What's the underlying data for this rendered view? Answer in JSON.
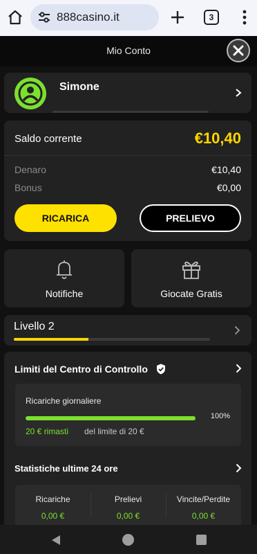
{
  "browser": {
    "url": "888casino.it",
    "tab_count": "3",
    "icons": [
      "home-icon",
      "site-settings-icon",
      "new-tab-icon",
      "tab-switcher-icon",
      "more-vert-icon"
    ]
  },
  "header": {
    "title": "Mio Conto"
  },
  "profile": {
    "name": "Simone"
  },
  "balance": {
    "current_label": "Saldo corrente",
    "current_value": "€10,40",
    "rows": [
      {
        "label": "Denaro",
        "value": "€10,40"
      },
      {
        "label": "Bonus",
        "value": "€0,00"
      }
    ],
    "deposit_label": "RICARICA",
    "withdraw_label": "PRELIEVO"
  },
  "tiles": {
    "notifications_label": "Notifiche",
    "free_games_label": "Giocate Gratis"
  },
  "level": {
    "label": "Livello 2",
    "progress_fraction": 0.38
  },
  "controls": {
    "title": "Limiti del Centro di Controllo",
    "limit": {
      "label": "Ricariche giornaliere",
      "percent_text": "100%",
      "progress_fraction": 1.0,
      "remaining": "20 € rimasti",
      "remaining_suffix": "del limite di 20 €"
    },
    "stats": {
      "title": "Statistiche ultime 24 ore",
      "columns": [
        {
          "label": "Ricariche",
          "value": "0,00 €"
        },
        {
          "label": "Prelievi",
          "value": "0,00 €"
        },
        {
          "label": "Vincite/Perdite",
          "value": "0,00 €"
        }
      ]
    }
  },
  "colors": {
    "accent_yellow": "#ffd600",
    "button_yellow": "#ffe100",
    "accent_green": "#7be02f",
    "card_bg": "#222222",
    "page_bg": "#111111"
  }
}
